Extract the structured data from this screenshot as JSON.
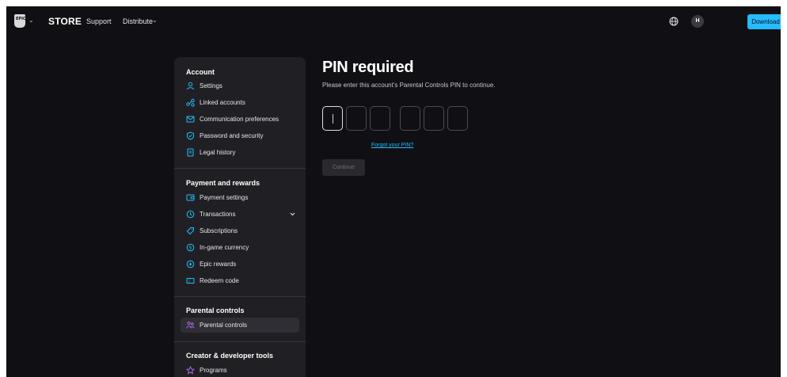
{
  "nav": {
    "logo_text": "EPIC",
    "store": "STORE",
    "support": "Support",
    "distribute": "Distribute",
    "avatar_initial": "H",
    "download": "Download"
  },
  "sidebar": {
    "sections": [
      {
        "title": "Account",
        "items": [
          {
            "label": "Settings",
            "icon": "person-icon"
          },
          {
            "label": "Linked accounts",
            "icon": "link-nodes-icon"
          },
          {
            "label": "Communication preferences",
            "icon": "mail-icon"
          },
          {
            "label": "Password and security",
            "icon": "shield-check-icon"
          },
          {
            "label": "Legal history",
            "icon": "document-icon"
          }
        ]
      },
      {
        "title": "Payment and rewards",
        "items": [
          {
            "label": "Payment settings",
            "icon": "wallet-icon"
          },
          {
            "label": "Transactions",
            "icon": "clock-icon"
          },
          {
            "label": "Subscriptions",
            "icon": "tag-icon"
          },
          {
            "label": "In-game currency",
            "icon": "coin-icon"
          },
          {
            "label": "Epic rewards",
            "icon": "rewards-icon"
          },
          {
            "label": "Redeem code",
            "icon": "ticket-icon"
          }
        ]
      },
      {
        "title": "Parental controls",
        "items": [
          {
            "label": "Parental controls",
            "icon": "family-icon",
            "active": true
          }
        ]
      },
      {
        "title": "Creator & developer tools",
        "items": [
          {
            "label": "Programs",
            "icon": "star-icon"
          }
        ]
      }
    ]
  },
  "main": {
    "title": "PIN required",
    "subtitle": "Please enter this account's Parental Controls PIN to continue.",
    "forgot": "Forgot your PIN?",
    "continue": "Continue"
  },
  "colors": {
    "background": "#101014",
    "sidebar": "#202024",
    "accent": "#26bbff",
    "active_icon": "#c06bff"
  }
}
